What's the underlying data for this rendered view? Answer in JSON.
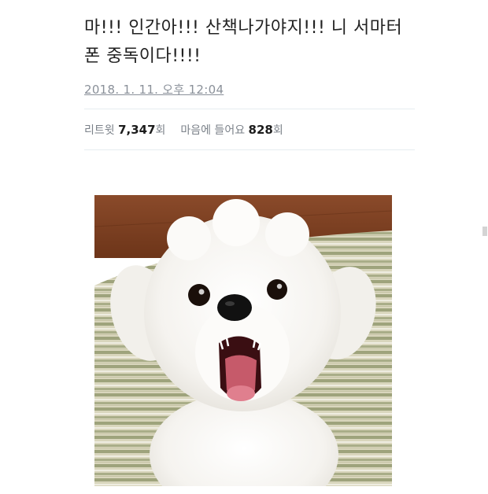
{
  "tweet": {
    "text": "마!!! 인간아!!! 산책나가야지!!! 니 서마터\n폰 중독이다!!!!",
    "timestamp": "2018. 1. 11. 오후 12:04"
  },
  "stats": {
    "retweet_label": "리트윗",
    "retweet_count": "7,347",
    "retweet_unit": "회",
    "like_label": "마음에 들어요",
    "like_count": "828",
    "like_unit": "회"
  },
  "photo": {
    "subject": "white-puppy-barking"
  },
  "colors": {
    "text": "#222222",
    "muted": "#8a9099",
    "divider": "#e6ecf0"
  }
}
